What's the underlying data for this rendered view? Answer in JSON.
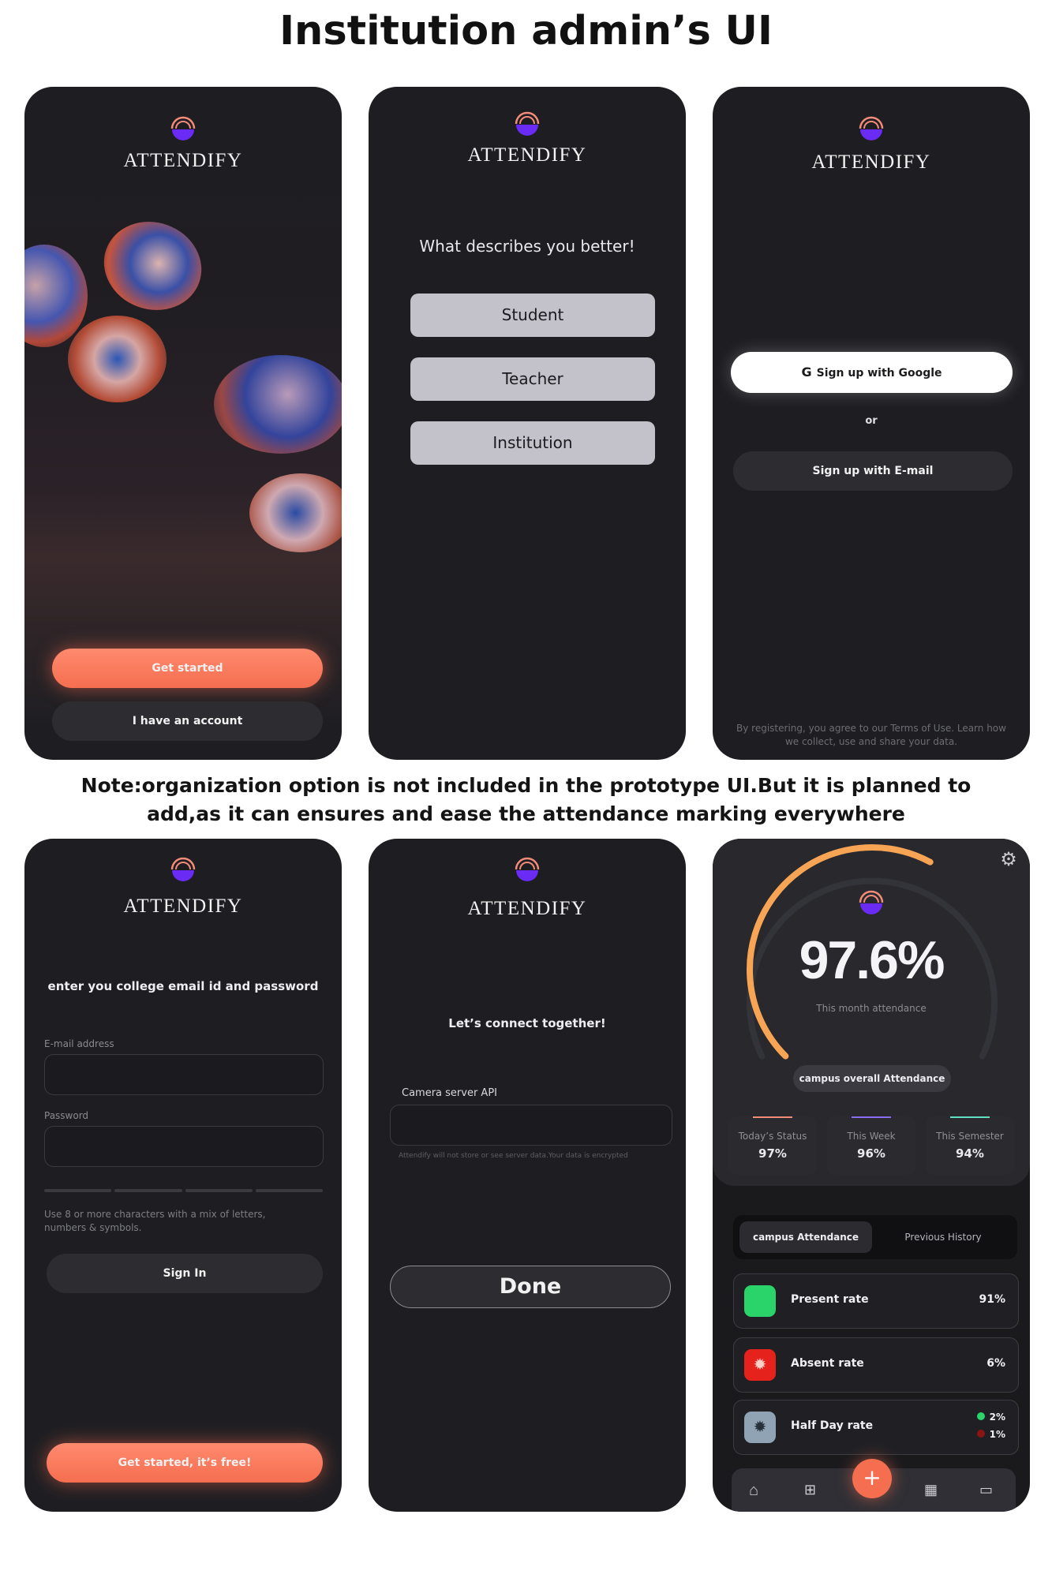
{
  "page_title": "Institution admin’s UI",
  "note": "Note:organization option is not included in the prototype UI.But it is planned to add,as it can ensures and ease the attendance marking everywhere",
  "brand": "ATTENDIFY",
  "screen1": {
    "get_started": "Get started",
    "have_account": "I have an account"
  },
  "screen2": {
    "question": "What describes you better!",
    "options": [
      "Student",
      "Teacher",
      "Institution"
    ]
  },
  "screen3": {
    "google": "Sign up with Google",
    "or": "or",
    "email": "Sign up with E-mail",
    "terms": "By registering, you agree to our Terms of Use. Learn how we collect, use and share your data."
  },
  "screen4": {
    "heading": "enter you college email id and password",
    "email_label": "E-mail address",
    "password_label": "Password",
    "hint": "Use 8 or more characters with a mix of letters, numbers & symbols.",
    "sign_in": "Sign In",
    "get_started": "Get started, it’s free!"
  },
  "screen5": {
    "heading": "Let’s connect together!",
    "api_label": "Camera server API",
    "disclaimer": "Attendify will not store or see server data.Your data is encrypted",
    "done": "Done"
  },
  "screen6": {
    "percentage": "97.6%",
    "gauge_fraction": 0.976,
    "caption": "This month attendance",
    "pill": "campus overall Attendance",
    "stats": [
      {
        "label": "Today’s Status",
        "value": "97%",
        "color": "#f28b7a"
      },
      {
        "label": "This Week",
        "value": "96%",
        "color": "#8a6bf0"
      },
      {
        "label": "This Semester",
        "value": "94%",
        "color": "#5fe0c2"
      }
    ],
    "tabs": [
      "campus Attendance",
      "Previous History"
    ],
    "rates": [
      {
        "label": "Present rate",
        "value": "91%",
        "color": "#2bd46a"
      },
      {
        "label": "Absent rate",
        "value": "6%",
        "color": "#e5221c"
      },
      {
        "label": "Half Day rate",
        "value_a": "2%",
        "value_b": "1%",
        "color": "#8fa3b4"
      }
    ],
    "fab": "+"
  },
  "colors": {
    "accent": "#f56e50",
    "background": "#1e1e22",
    "gauge": "#f7a455"
  }
}
